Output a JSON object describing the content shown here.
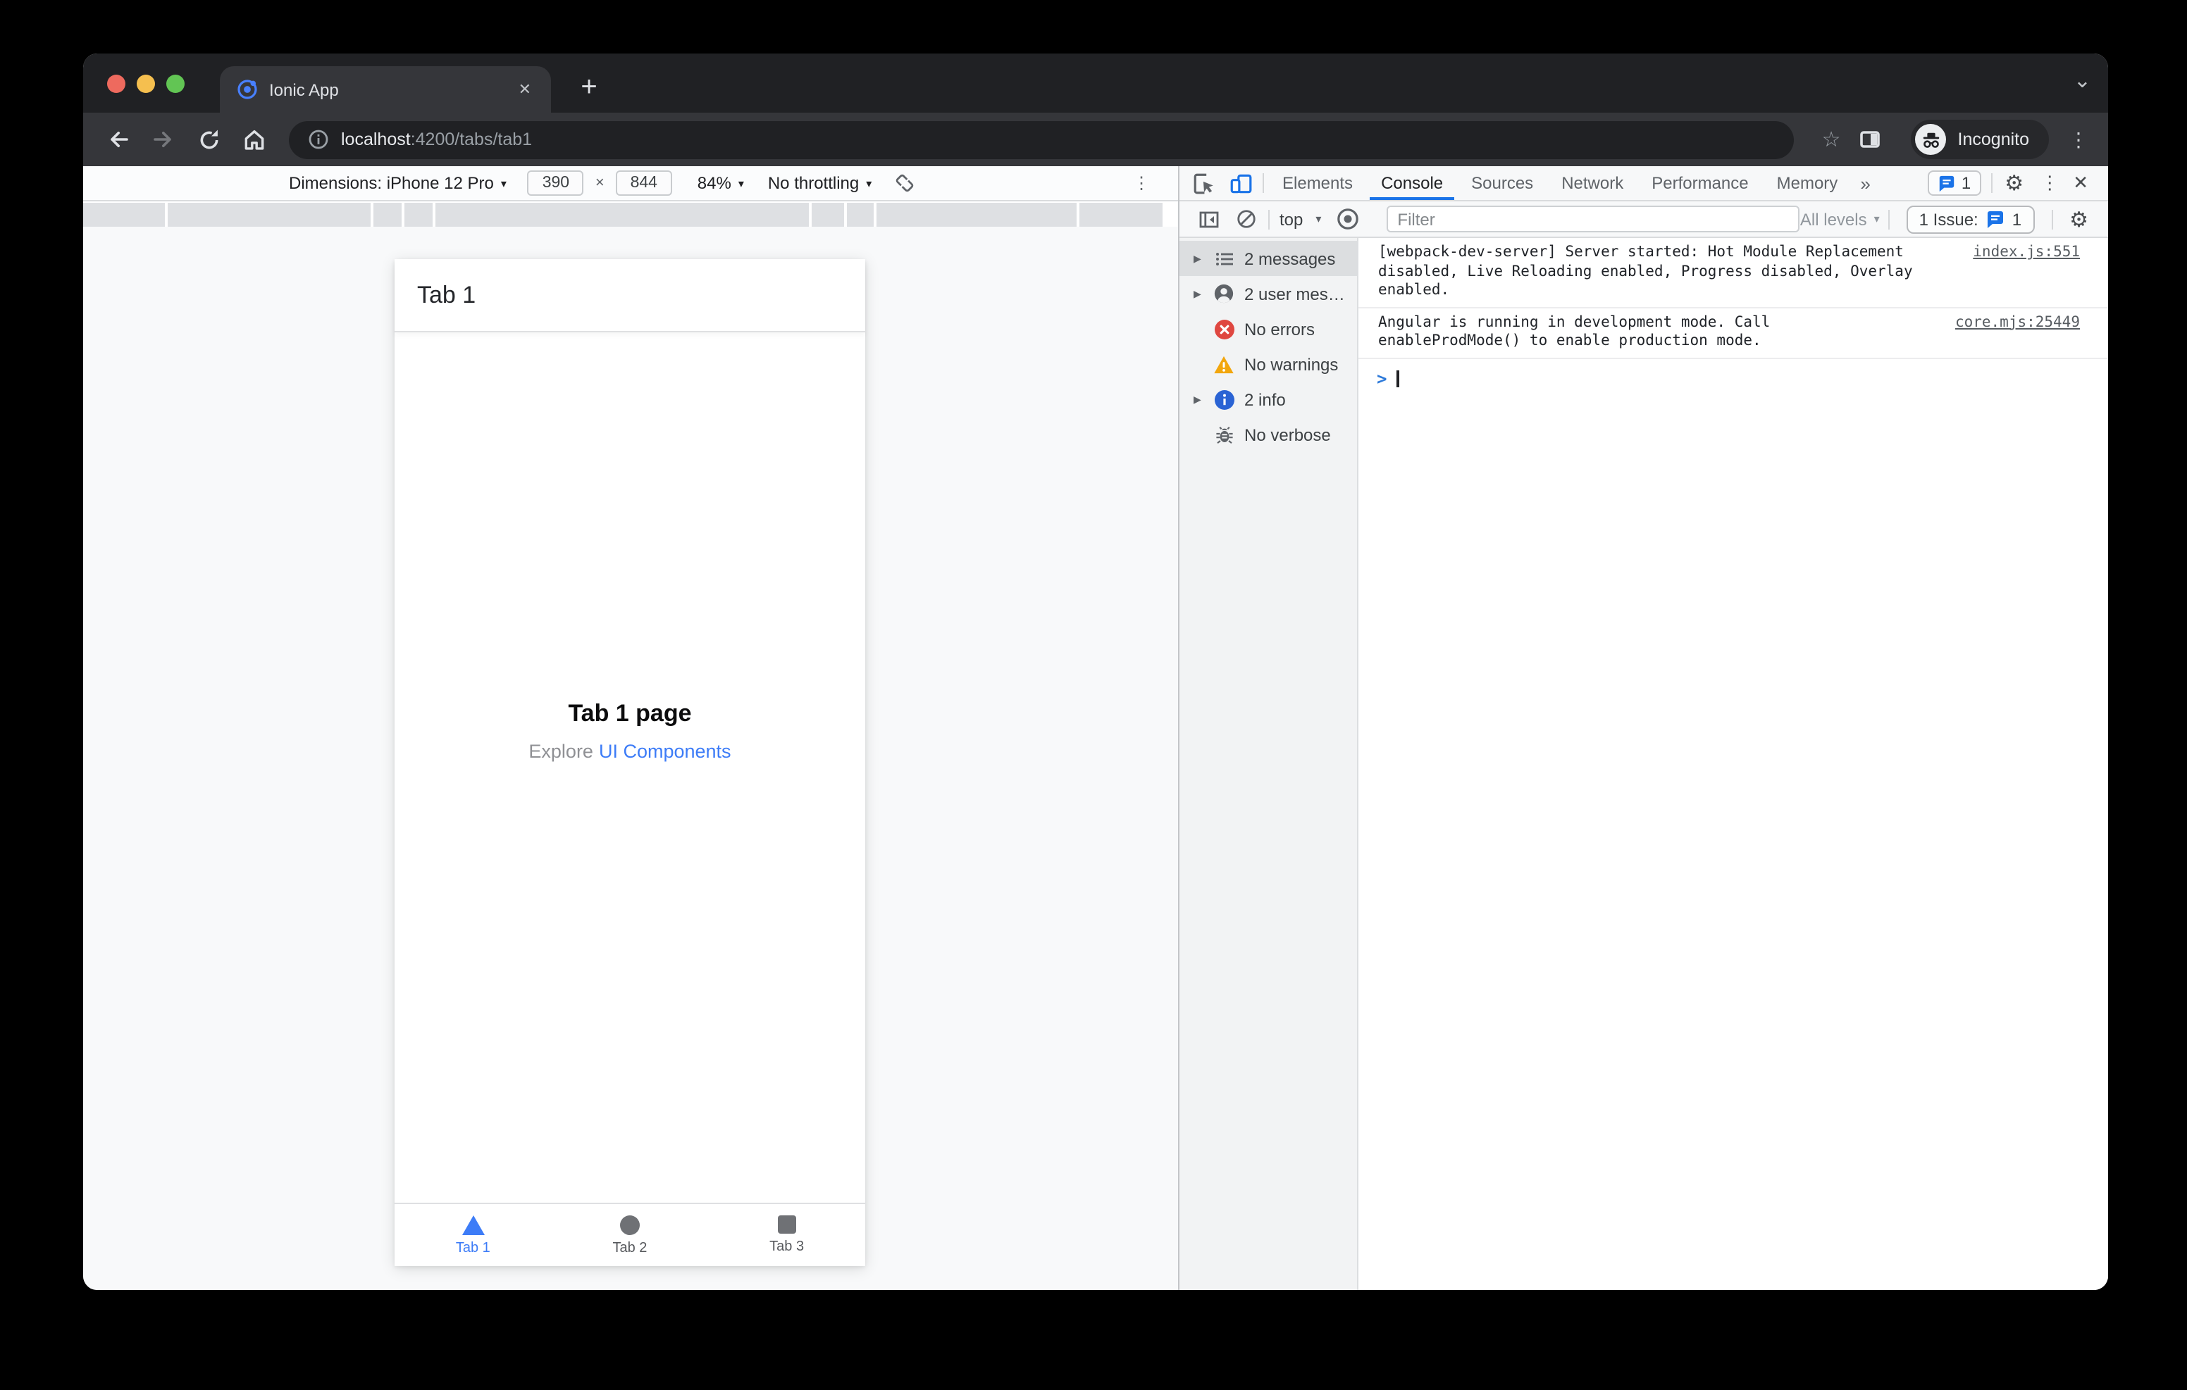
{
  "icons": {
    "kebab": "⋮",
    "star": "☆",
    "plus": "+",
    "close_tab": "✕",
    "chevron_down": "⌄",
    "gear": "⚙",
    "more_tabs": "»",
    "times": "×",
    "caret_down": "▾",
    "disclosure": "▶",
    "prompt_chevron": ">",
    "close_devtools": "✕"
  },
  "browser": {
    "tab_title": "Ionic App",
    "url_host": "localhost",
    "url_rest": ":4200/tabs/tab1",
    "incognito_label": "Incognito"
  },
  "device_toolbar": {
    "dimensions_label": "Dimensions: iPhone 12 Pro",
    "width": "390",
    "height": "844",
    "zoom": "84%",
    "throttling": "No throttling"
  },
  "devtools": {
    "tabs": [
      {
        "label": "Elements"
      },
      {
        "label": "Console"
      },
      {
        "label": "Sources"
      },
      {
        "label": "Network"
      },
      {
        "label": "Performance"
      },
      {
        "label": "Memory"
      }
    ],
    "active_tab": "Console",
    "tab_issue_count": "1",
    "toolbar": {
      "context": "top",
      "filter_placeholder": "Filter",
      "levels": "All levels",
      "issue_label": "1 Issue:",
      "issue_count": "1"
    },
    "sidebar": {
      "items": [
        {
          "label": "2 messages"
        },
        {
          "label": "2 user mes…"
        },
        {
          "label": "No errors"
        },
        {
          "label": "No warnings"
        },
        {
          "label": "2 info"
        },
        {
          "label": "No verbose"
        }
      ]
    },
    "console": {
      "messages": [
        {
          "lines": [
            "[webpack-dev-server] Server started: Hot Module Replacement",
            "disabled, Live Reloading enabled, Progress disabled, Overlay enabled."
          ],
          "source": "index.js:551"
        },
        {
          "lines": [
            "Angular is running in development mode. Call",
            "enableProdMode() to enable production mode."
          ],
          "source": "core.mjs:25449"
        }
      ]
    }
  },
  "app": {
    "header_title": "Tab 1",
    "page_title": "Tab 1 page",
    "subtitle_text": "Explore",
    "subtitle_link": "UI Components",
    "tabs": [
      {
        "label": "Tab 1"
      },
      {
        "label": "Tab 2"
      },
      {
        "label": "Tab 3"
      }
    ]
  },
  "colors": {
    "accent_blue": "#1a73e8",
    "ionic_blue": "#3d7cf7",
    "error_red": "#df4740",
    "warning_yellow": "#f2a60d",
    "info_blue": "#2a63d4",
    "incognito_dark": "#202124",
    "toolbar_dark": "#35363a"
  }
}
